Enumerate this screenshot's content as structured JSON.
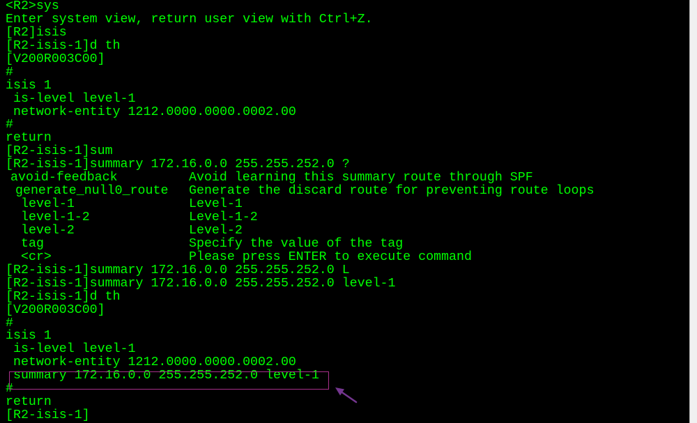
{
  "colors": {
    "background": "#000000",
    "text": "#00ff00",
    "highlight_box": "#a8308a",
    "arrow": "#74368f",
    "scrollbar_track": "#f0f0f0"
  },
  "terminal": {
    "lines_before_help": [
      "<R2>sys",
      "Enter system view, return user view with Ctrl+Z.",
      "[R2]isis",
      "[R2-isis-1]d th",
      "[V200R003C00]",
      "#",
      "isis 1",
      " is-level level-1",
      " network-entity 1212.0000.0000.0002.00",
      "#",
      "return",
      "[R2-isis-1]sum",
      "[R2-isis-1]summary 172.16.0.0 255.255.252.0 ?"
    ],
    "help_rows": [
      {
        "keyword": "avoid-feedback",
        "description": "Avoid learning this summary route through SPF"
      },
      {
        "keyword": "generate_null0_route",
        "description": "Generate the discard route for preventing route loops"
      },
      {
        "keyword": "level-1",
        "description": "Level-1"
      },
      {
        "keyword": "level-1-2",
        "description": "Level-1-2"
      },
      {
        "keyword": "level-2",
        "description": "Level-2"
      },
      {
        "keyword": "tag",
        "description": "Specify the value of the tag"
      },
      {
        "keyword": "<cr>",
        "description": "Please press ENTER to execute command"
      }
    ],
    "lines_after_help": [
      "[R2-isis-1]summary 172.16.0.0 255.255.252.0 L",
      "[R2-isis-1]summary 172.16.0.0 255.255.252.0 level-1",
      "[R2-isis-1]d th",
      "[V200R003C00]",
      "#",
      "isis 1",
      " is-level level-1",
      " network-entity 1212.0000.0000.0002.00",
      " summary 172.16.0.0 255.255.252.0 level-1",
      "#",
      "return",
      "[R2-isis-1]"
    ]
  }
}
